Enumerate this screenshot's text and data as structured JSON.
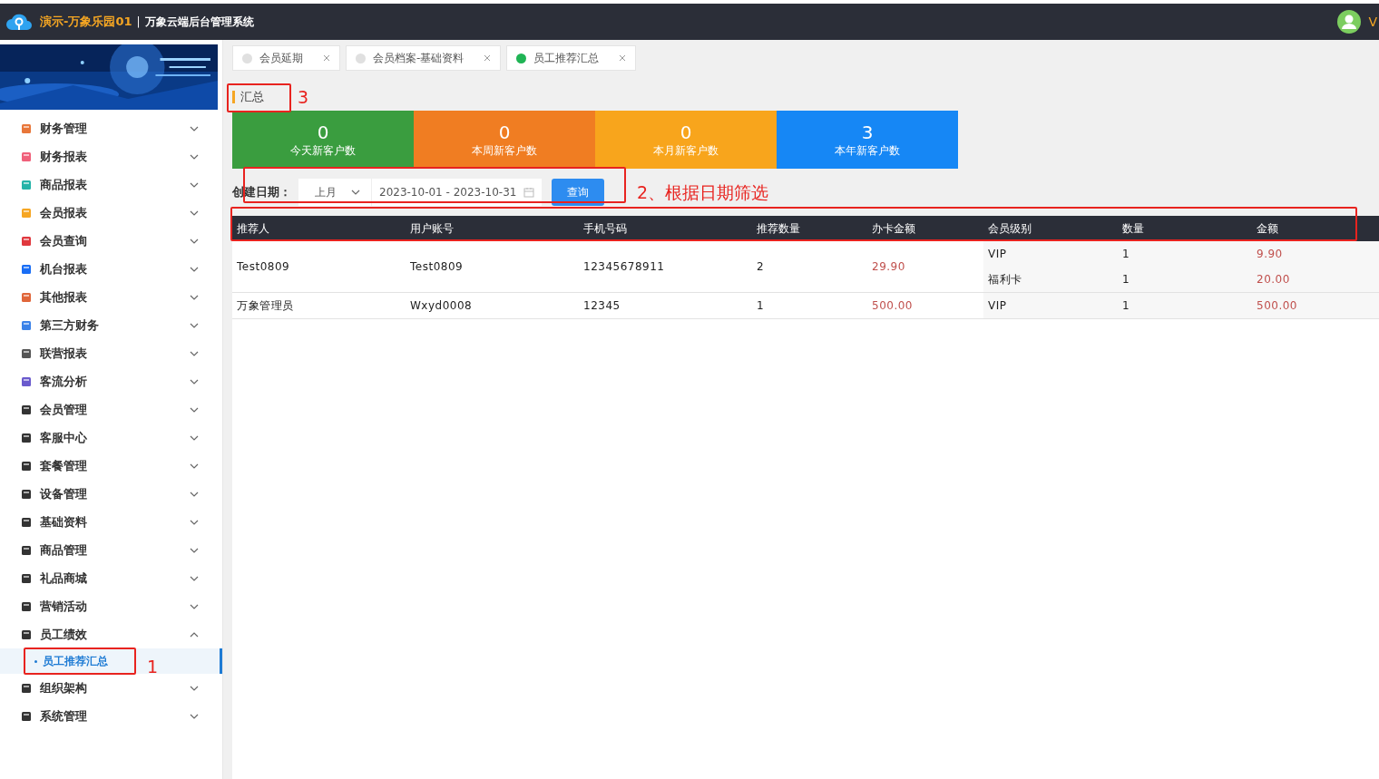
{
  "header": {
    "site": "演示-万象乐园01",
    "separator": "|",
    "system": "万象云端后台管理系统",
    "user": "V"
  },
  "sidebar": {
    "items": [
      {
        "label": "财务管理",
        "expanded": false
      },
      {
        "label": "财务报表",
        "expanded": false
      },
      {
        "label": "商品报表",
        "expanded": false
      },
      {
        "label": "会员报表",
        "expanded": false
      },
      {
        "label": "会员查询",
        "expanded": false
      },
      {
        "label": "机台报表",
        "expanded": false
      },
      {
        "label": "其他报表",
        "expanded": false
      },
      {
        "label": "第三方财务",
        "expanded": false
      },
      {
        "label": "联营报表",
        "expanded": false
      },
      {
        "label": "客流分析",
        "expanded": false
      },
      {
        "label": "会员管理",
        "expanded": false
      },
      {
        "label": "客服中心",
        "expanded": false
      },
      {
        "label": "套餐管理",
        "expanded": false
      },
      {
        "label": "设备管理",
        "expanded": false
      },
      {
        "label": "基础资料",
        "expanded": false
      },
      {
        "label": "商品管理",
        "expanded": false
      },
      {
        "label": "礼品商城",
        "expanded": false
      },
      {
        "label": "营销活动",
        "expanded": false
      },
      {
        "label": "员工绩效",
        "expanded": true,
        "children": [
          {
            "label": "员工推荐汇总",
            "selected": true
          }
        ]
      },
      {
        "label": "组织架构",
        "expanded": false
      },
      {
        "label": "系统管理",
        "expanded": false
      }
    ]
  },
  "tabs": [
    {
      "label": "会员延期",
      "selected": false
    },
    {
      "label": "会员档案-基础资料",
      "selected": false
    },
    {
      "label": "员工推荐汇总",
      "selected": true
    }
  ],
  "section_title": "汇总",
  "stats": [
    {
      "value": "0",
      "label": "今天新客户数",
      "color": "#3a9d3f"
    },
    {
      "value": "0",
      "label": "本周新客户数",
      "color": "#f07d22"
    },
    {
      "value": "0",
      "label": "本月新客户数",
      "color": "#f8a51c"
    },
    {
      "value": "3",
      "label": "本年新客户数",
      "color": "#1687f5"
    }
  ],
  "filter": {
    "label": "创建日期：",
    "period": "上月",
    "date_range": "2023-10-01 - 2023-10-31",
    "button": "查询"
  },
  "table": {
    "columns": [
      "推荐人",
      "用户账号",
      "手机号码",
      "推荐数量",
      "办卡金额",
      "会员级别",
      "数量",
      "金额"
    ],
    "rows": [
      {
        "referrer": "Test0809",
        "account": "Test0809",
        "phone": "12345678911",
        "count": "2",
        "card_amount": "29.90",
        "levels": [
          {
            "level": "VIP",
            "qty": "1",
            "amount": "9.90"
          },
          {
            "level": "福利卡",
            "qty": "1",
            "amount": "20.00"
          }
        ]
      },
      {
        "referrer": "万象管理员",
        "account": "Wxyd0008",
        "phone": "12345",
        "count": "1",
        "card_amount": "500.00",
        "levels": [
          {
            "level": "VIP",
            "qty": "1",
            "amount": "500.00"
          }
        ]
      }
    ]
  },
  "annotations": [
    {
      "label": "1"
    },
    {
      "label": "2、根据日期筛选"
    },
    {
      "label": "3"
    }
  ]
}
